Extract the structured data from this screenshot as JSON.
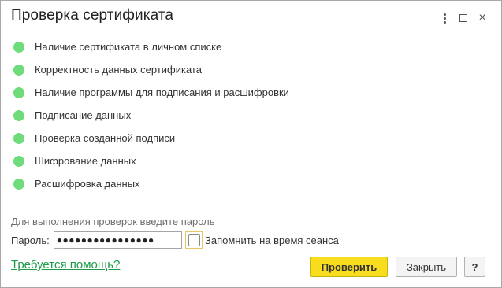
{
  "window": {
    "title": "Проверка сертификата",
    "menu_icon": "more-vertical-icon",
    "maximize_icon": "maximize-icon",
    "close_icon": "close-icon",
    "close_glyph": "×"
  },
  "checks": {
    "status_color": "#6fdc7b",
    "items": [
      {
        "label": "Наличие сертификата в личном списке"
      },
      {
        "label": "Корректность данных сертификата"
      },
      {
        "label": "Наличие программы для подписания и расшифровки"
      },
      {
        "label": "Подписание данных"
      },
      {
        "label": "Проверка созданной подписи"
      },
      {
        "label": "Шифрование данных"
      },
      {
        "label": "Расшифровка данных"
      }
    ]
  },
  "password": {
    "hint": "Для выполнения проверок введите пароль",
    "label": "Пароль:",
    "value": "●●●●●●●●●●●●●●●●",
    "remember_label": "Запомнить на время сеанса",
    "remember_checked": false
  },
  "footer": {
    "help_link": "Требуется помощь?",
    "check_button": "Проверить",
    "close_button": "Закрыть",
    "help_button": "?"
  },
  "colors": {
    "primary_button": "#f7dd1e",
    "link": "#1e9a4a"
  }
}
